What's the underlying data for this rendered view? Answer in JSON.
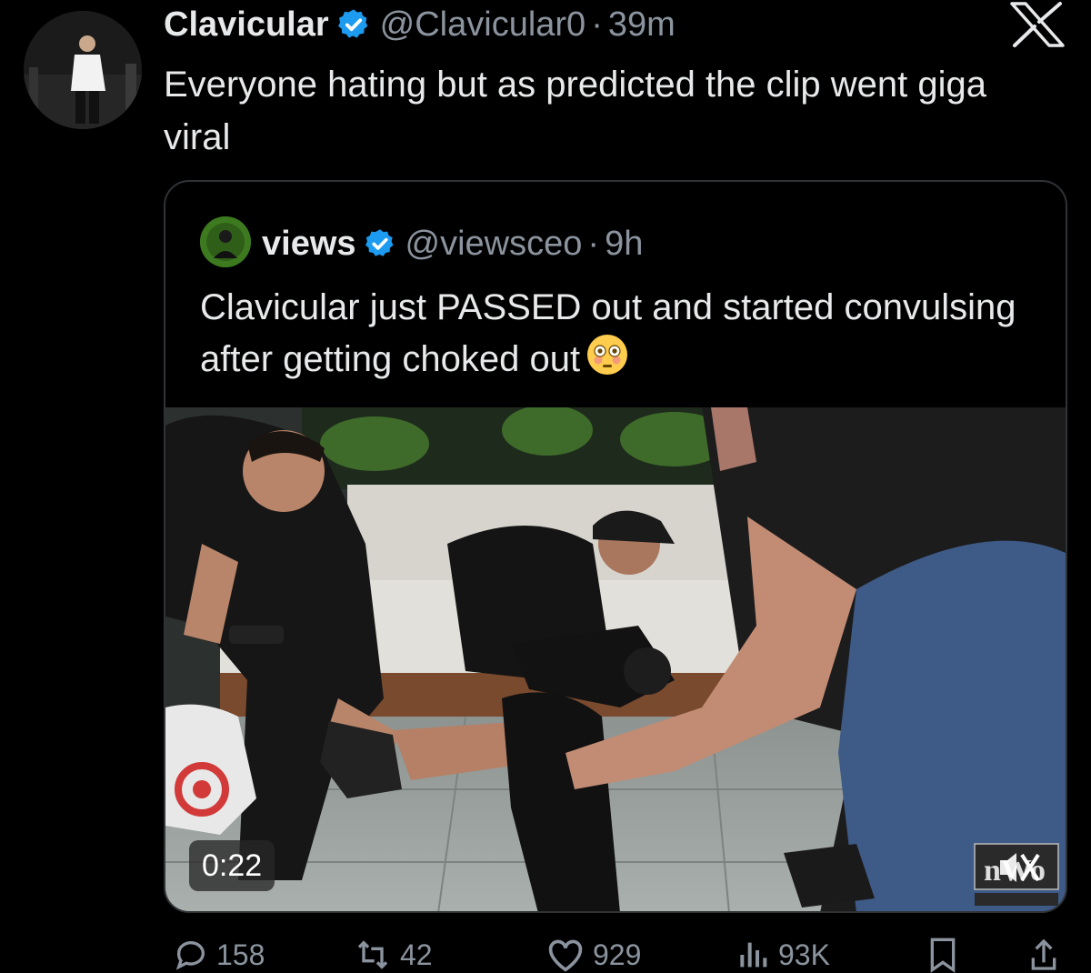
{
  "post": {
    "author_name": "Clavicular",
    "handle": "@Clavicular0",
    "separator": "·",
    "time": "39m",
    "text": "Everyone hating but as predicted the clip went giga viral"
  },
  "quoted": {
    "author_name": "views",
    "handle": "@viewsceo",
    "separator": "·",
    "time": "9h",
    "text": "Clavicular just PASSED out and started convulsing after getting choked out",
    "emoji": "flushed-face",
    "video_duration": "0:22",
    "video_muted": true
  },
  "actions": {
    "replies": "158",
    "reposts": "42",
    "likes": "929",
    "views": "93K"
  },
  "colors": {
    "background": "#000000",
    "text": "#e7e9ea",
    "muted": "#8b949e",
    "verified": "#1d9bf0",
    "border": "#2f3336"
  },
  "icons": [
    "x-logo-icon",
    "verified-badge-icon",
    "reply-icon",
    "repost-icon",
    "like-icon",
    "views-icon",
    "bookmark-icon",
    "share-icon",
    "mute-icon"
  ]
}
